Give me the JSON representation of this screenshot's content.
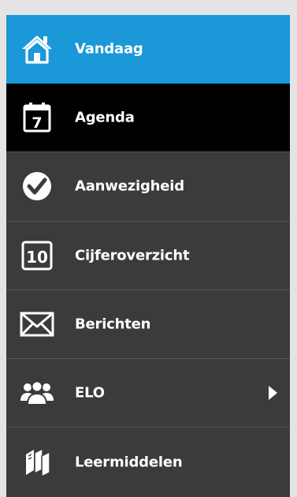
{
  "menu": {
    "items": [
      {
        "label": "Vandaag",
        "icon": "home-icon",
        "state": "active"
      },
      {
        "label": "Agenda",
        "icon": "calendar-icon",
        "icon_text": "7",
        "state": "selected"
      },
      {
        "label": "Aanwezigheid",
        "icon": "checkmark-icon",
        "state": "normal"
      },
      {
        "label": "Cijferoverzicht",
        "icon": "grade-icon",
        "icon_text": "10",
        "state": "normal"
      },
      {
        "label": "Berichten",
        "icon": "envelope-icon",
        "state": "normal"
      },
      {
        "label": "ELO",
        "icon": "users-icon",
        "state": "normal",
        "has_submenu": true
      },
      {
        "label": "Leermiddelen",
        "icon": "books-icon",
        "state": "normal"
      }
    ]
  },
  "colors": {
    "active_background": "#1a98d8",
    "selected_background": "#000000",
    "menu_background": "#3b3b3b",
    "text": "#ffffff"
  }
}
